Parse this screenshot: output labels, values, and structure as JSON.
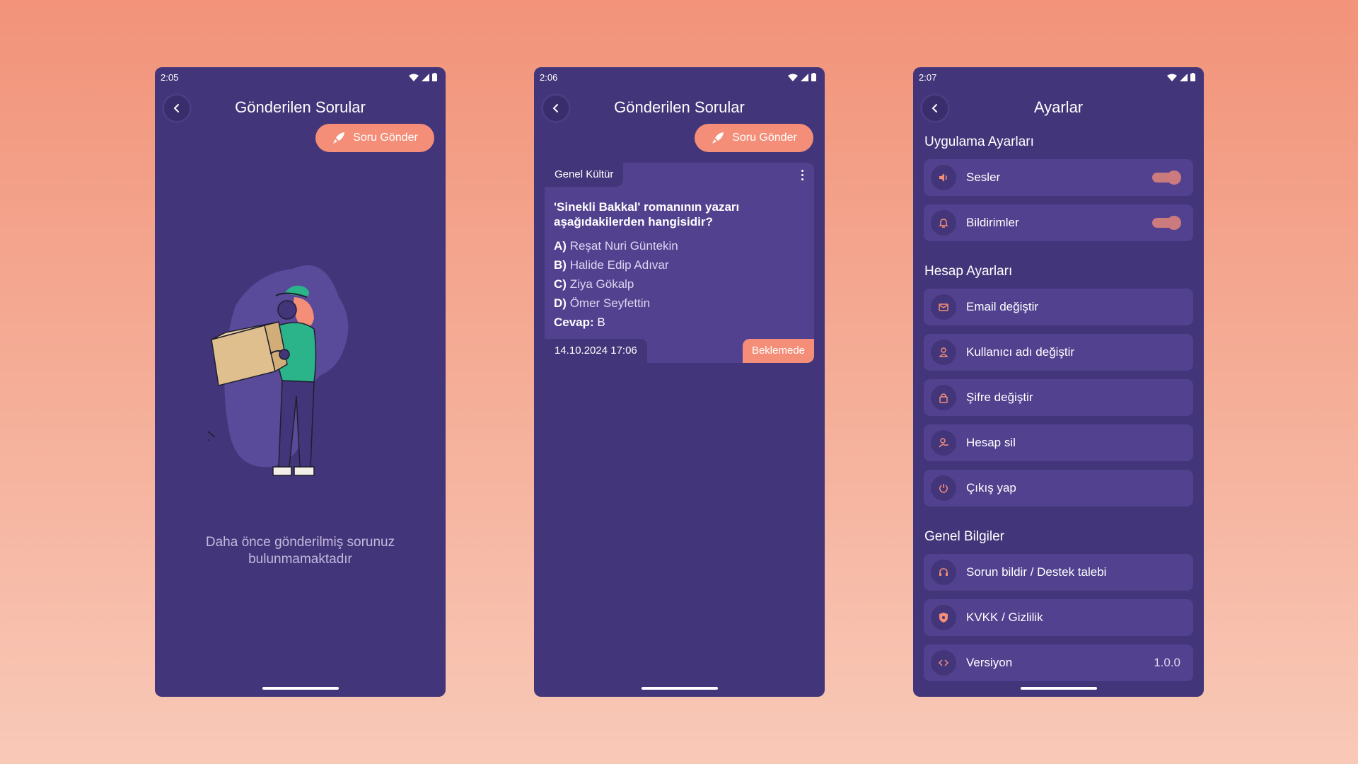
{
  "colors": {
    "background_top": "#f2937a",
    "phone_bg": "#433579",
    "card_bg": "#52418f",
    "accent": "#f48e78"
  },
  "phone1": {
    "status_time": "2:05",
    "title": "Gönderilen Sorular",
    "send_button": "Soru Gönder",
    "empty_message": "Daha önce gönderilmiş sorunuz bulunmamaktadır"
  },
  "phone2": {
    "status_time": "2:06",
    "title": "Gönderilen Sorular",
    "send_button": "Soru Gönder",
    "question": {
      "category": "Genel Kültür",
      "text": "'Sinekli Bakkal' romanının yazarı aşağıdakilerden hangisidir?",
      "options": [
        {
          "key": "A)",
          "text": "Reşat Nuri Güntekin"
        },
        {
          "key": "B)",
          "text": "Halide Edip Adıvar"
        },
        {
          "key": "C)",
          "text": "Ziya Gökalp"
        },
        {
          "key": "D)",
          "text": "Ömer Seyfettin"
        }
      ],
      "answer_label": "Cevap:",
      "answer_value": "B",
      "date": "14.10.2024 17:06",
      "status": "Beklemede"
    }
  },
  "phone3": {
    "status_time": "2:07",
    "title": "Ayarlar",
    "sections": {
      "app": "Uygulama Ayarları",
      "account": "Hesap Ayarları",
      "general": "Genel Bilgiler"
    },
    "app_items": [
      {
        "label": "Sesler",
        "icon": "speaker-icon",
        "toggle": true
      },
      {
        "label": "Bildirimler",
        "icon": "bell-icon",
        "toggle": true
      }
    ],
    "account_items": [
      {
        "label": "Email değiştir",
        "icon": "mail-icon"
      },
      {
        "label": "Kullanıcı adı değiştir",
        "icon": "user-icon"
      },
      {
        "label": "Şifre değiştir",
        "icon": "lock-icon"
      },
      {
        "label": "Hesap sil",
        "icon": "user-remove-icon"
      },
      {
        "label": "Çıkış yap",
        "icon": "power-icon"
      }
    ],
    "general_items": [
      {
        "label": "Sorun bildir / Destek talebi",
        "icon": "support-icon"
      },
      {
        "label": "KVKK / Gizlilik",
        "icon": "shield-icon"
      },
      {
        "label": "Versiyon",
        "icon": "code-icon",
        "value": "1.0.0"
      }
    ]
  }
}
